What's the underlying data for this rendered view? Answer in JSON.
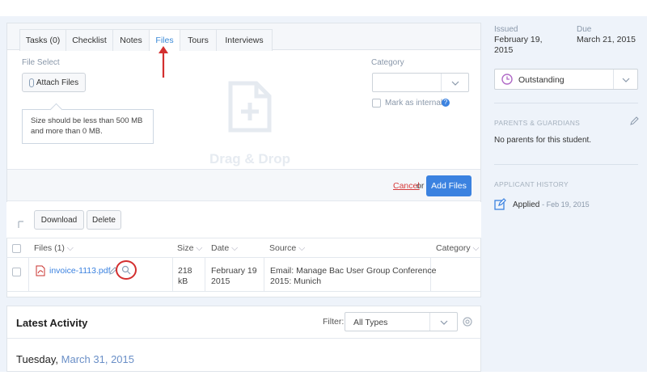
{
  "tabs": [
    {
      "label": "Tasks (0)"
    },
    {
      "label": "Checklist"
    },
    {
      "label": "Notes"
    },
    {
      "label": "Files"
    },
    {
      "label": "Tours"
    },
    {
      "label": "Interviews"
    }
  ],
  "upload": {
    "file_select_label": "File Select",
    "attach_label": "Attach Files",
    "tooltip_line1": "Size should be less than 500 MB",
    "tooltip_line2": "and more than 0 MB.",
    "dropzone_text": "Drag & Drop",
    "category_label": "Category",
    "mark_internal_label": "Mark as internal",
    "cancel_label": "Cancel",
    "or_label": "or",
    "add_files_label": "Add Files"
  },
  "file_actions": {
    "download_label": "Download",
    "delete_label": "Delete"
  },
  "files_table": {
    "headers": [
      "Files (1)",
      "Size",
      "Date",
      "Source",
      "Category"
    ],
    "rows": [
      {
        "name": "invoice-1113.pdf",
        "size_line1": "218",
        "size_line2": "kB",
        "date_line1": "February 19",
        "date_line2": "2015",
        "source_line1": "Email: Manage Bac User Group Conference",
        "source_line2": "2015: Munich",
        "category": ""
      }
    ]
  },
  "activity": {
    "title": "Latest Activity",
    "filter_label": "Filter:",
    "filter_value": "All Types",
    "day": "Tuesday,",
    "date": "March 31, 2015"
  },
  "sidebar": {
    "issued_label": "Issued",
    "issued_line1": "February 19,",
    "issued_line2": "2015",
    "due_label": "Due",
    "due_value": "March 21, 2015",
    "status": "Outstanding",
    "parents_heading": "PARENTS & GUARDIANS",
    "parents_text": "No parents for this student.",
    "history_heading": "APPLICANT HISTORY",
    "history_item": "Applied",
    "history_date": "- Feb 19, 2015"
  },
  "colors": {
    "accent": "#3b82e0",
    "annotation": "#d32f2f",
    "status_purple": "#b06ac7"
  }
}
